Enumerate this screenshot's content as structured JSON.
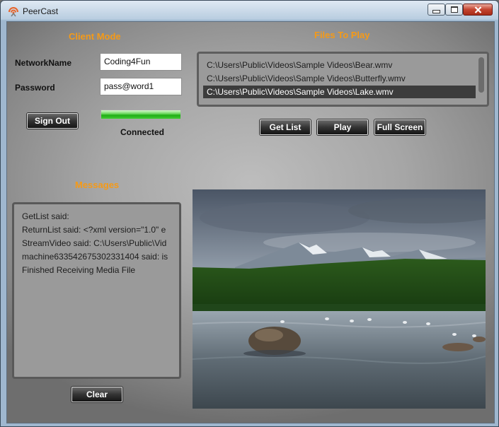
{
  "window": {
    "title": "PeerCast"
  },
  "client_mode": {
    "heading": "Client Mode",
    "network_name_label": "NetworkName",
    "network_name_value": "Coding4Fun",
    "password_label": "Password",
    "password_value": "pass@word1",
    "sign_out_label": "Sign Out",
    "progress": 1.0,
    "status": "Connected"
  },
  "files": {
    "heading": "Files To Play",
    "items": [
      "C:\\Users\\Public\\Videos\\Sample Videos\\Bear.wmv",
      "C:\\Users\\Public\\Videos\\Sample Videos\\Butterfly.wmv",
      "C:\\Users\\Public\\Videos\\Sample Videos\\Lake.wmv"
    ],
    "selected_index": 2,
    "get_list_label": "Get List",
    "play_label": "Play",
    "full_screen_label": "Full Screen"
  },
  "messages": {
    "heading": "Messages",
    "lines": [
      "GetList said:",
      "ReturnList said: <?xml version=\"1.0\" e",
      "StreamVideo said: C:\\Users\\Public\\Vid",
      "machine633542675302331404 said:  is",
      "Finished Receiving Media File"
    ],
    "clear_label": "Clear"
  },
  "colors": {
    "accent": "#f59a17",
    "progress": "#2fbf22"
  },
  "icons": {
    "app": "peercast-broadcast-icon"
  }
}
